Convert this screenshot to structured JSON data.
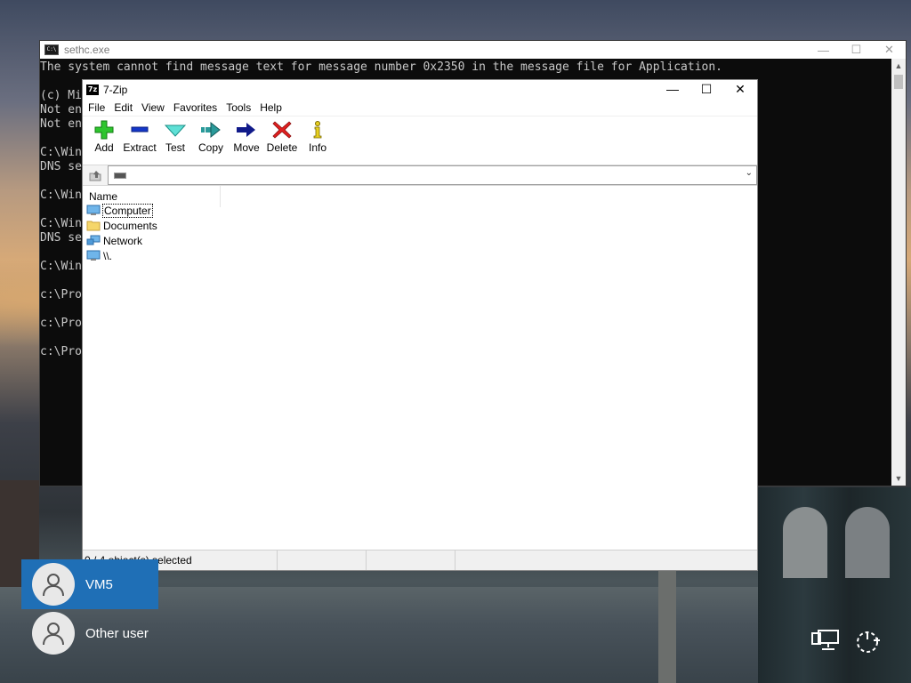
{
  "console": {
    "title": "sethc.exe",
    "lines": [
      "The system cannot find message text for message number 0x2350 in the message file for Application.",
      "",
      "(c) Mi",
      "Not en",
      "Not en",
      "",
      "C:\\Win",
      "DNS se",
      "",
      "C:\\Win",
      "",
      "C:\\Win",
      "DNS se",
      "",
      "C:\\Win",
      "",
      "c:\\Pro",
      "",
      "c:\\Pro",
      "",
      "c:\\Pro"
    ],
    "controls": {
      "minimize": "—",
      "maximize": "☐",
      "close": "✕"
    }
  },
  "zip": {
    "title": "7-Zip",
    "app_icon_text": "7z",
    "menu": [
      "File",
      "Edit",
      "View",
      "Favorites",
      "Tools",
      "Help"
    ],
    "toolbar": [
      {
        "label": "Add",
        "icon": "plus-icon"
      },
      {
        "label": "Extract",
        "icon": "minus-icon"
      },
      {
        "label": "Test",
        "icon": "checkmark-icon"
      },
      {
        "label": "Copy",
        "icon": "copy-arrow-icon"
      },
      {
        "label": "Move",
        "icon": "move-arrow-icon"
      },
      {
        "label": "Delete",
        "icon": "delete-x-icon"
      },
      {
        "label": "Info",
        "icon": "info-icon"
      }
    ],
    "address_value": "",
    "list_header": "Name",
    "items": [
      {
        "label": "Computer",
        "icon": "computer-icon",
        "focused": true
      },
      {
        "label": "Documents",
        "icon": "folder-icon",
        "focused": false
      },
      {
        "label": "Network",
        "icon": "network-icon",
        "focused": false
      },
      {
        "label": "\\\\.",
        "icon": "computer-icon",
        "focused": false
      }
    ],
    "status": "0 / 4 object(s) selected",
    "controls": {
      "minimize": "—",
      "maximize": "☐",
      "close": "✕"
    }
  },
  "login": {
    "users": [
      {
        "name": "VM5",
        "selected": true
      },
      {
        "name": "Other user",
        "selected": false
      }
    ]
  },
  "system_icons": [
    "network-icon",
    "power-icon"
  ],
  "colors": {
    "selected_user_bg": "#1f6fb6",
    "console_bg": "#0c0c0c"
  }
}
